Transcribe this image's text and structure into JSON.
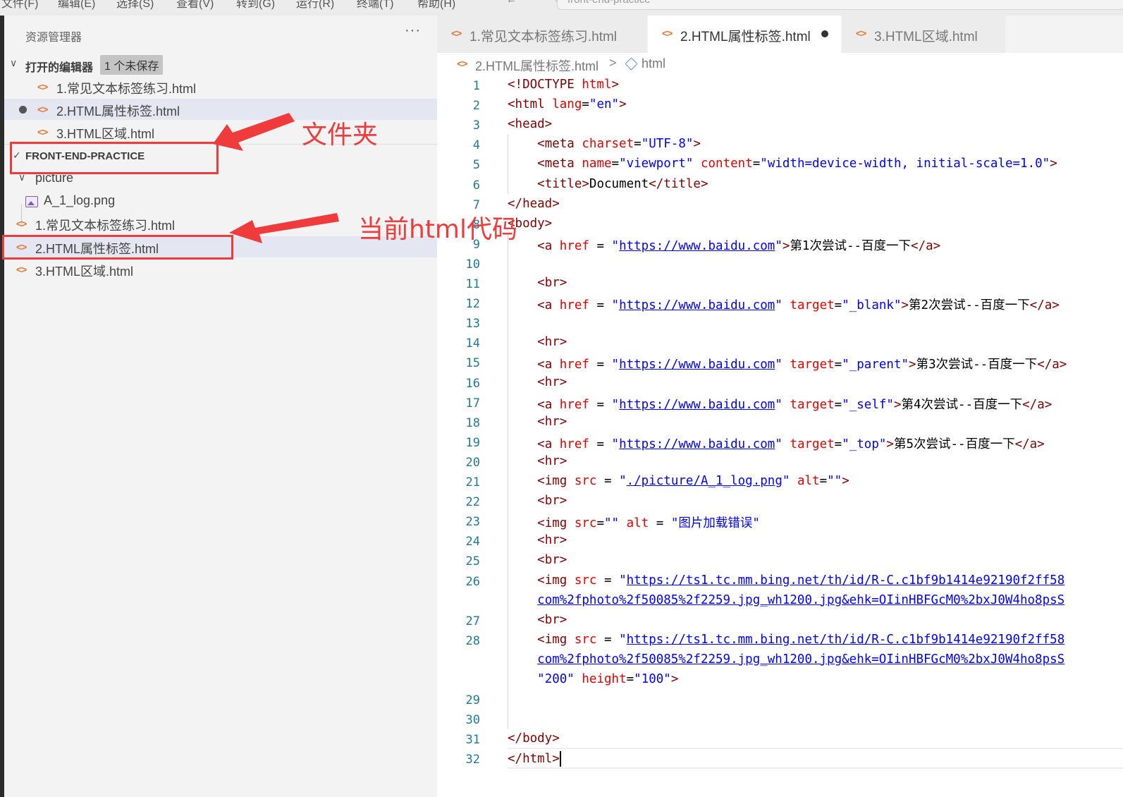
{
  "menubar": {
    "items": [
      "文件(F)",
      "编辑(E)",
      "选择(S)",
      "查看(V)",
      "转到(G)",
      "运行(R)",
      "终端(T)",
      "帮助(H)"
    ],
    "nav_arrows": "← →",
    "command_center_text": "front-end-practice"
  },
  "sidebar": {
    "title": "资源管理器",
    "more_icon": "···",
    "open_editors": {
      "label": "打开的编辑器",
      "badge": "1 个未保存",
      "files": [
        "1.常见文本标签练习.html",
        "2.HTML属性标签.html",
        "3.HTML区域.html"
      ]
    },
    "folder": {
      "label": "FRONT-END-PRACTICE",
      "subfolder": "picture",
      "subfolder_files": [
        "A_1_log.png"
      ],
      "files": [
        "1.常见文本标签练习.html",
        "2.HTML属性标签.html",
        "3.HTML区域.html"
      ]
    }
  },
  "annotations": {
    "folder_note": "文件夹",
    "current_note": "当前html代码",
    "color": "#ef3b3b"
  },
  "tabs": [
    {
      "label": "1.常见文本标签练习.html",
      "active": false,
      "dirty": false
    },
    {
      "label": "2.HTML属性标签.html",
      "active": true,
      "dirty": true
    },
    {
      "label": "3.HTML区域.html",
      "active": false,
      "dirty": false
    }
  ],
  "breadcrumb": {
    "file": "2.HTML属性标签.html",
    "separator": ">",
    "node": "html"
  },
  "editor": {
    "lines": [
      {
        "n": "1",
        "parts": [
          [
            "t",
            "<!DOCTYPE "
          ],
          [
            "a",
            "html"
          ],
          [
            "t",
            ">"
          ]
        ]
      },
      {
        "n": "2",
        "parts": [
          [
            "t",
            "<html "
          ],
          [
            "a",
            "lang"
          ],
          [
            "p",
            "="
          ],
          [
            "v",
            "\"en\""
          ],
          [
            "t",
            ">"
          ]
        ]
      },
      {
        "n": "3",
        "parts": [
          [
            "t",
            "<head>"
          ]
        ]
      },
      {
        "n": "4",
        "parts": [
          [
            "p",
            "    "
          ],
          [
            "t",
            "<meta "
          ],
          [
            "a",
            "charset"
          ],
          [
            "p",
            "="
          ],
          [
            "v",
            "\"UTF-8\""
          ],
          [
            "t",
            ">"
          ]
        ]
      },
      {
        "n": "5",
        "parts": [
          [
            "p",
            "    "
          ],
          [
            "t",
            "<meta "
          ],
          [
            "a",
            "name"
          ],
          [
            "p",
            "="
          ],
          [
            "v",
            "\"viewport\""
          ],
          [
            "p",
            " "
          ],
          [
            "a",
            "content"
          ],
          [
            "p",
            "="
          ],
          [
            "v",
            "\"width=device-width, initial-scale=1.0\""
          ],
          [
            "t",
            ">"
          ]
        ]
      },
      {
        "n": "6",
        "parts": [
          [
            "p",
            "    "
          ],
          [
            "t",
            "<title>"
          ],
          [
            "p",
            "Document"
          ],
          [
            "t",
            "</title>"
          ]
        ]
      },
      {
        "n": "7",
        "parts": [
          [
            "t",
            "</head>"
          ]
        ]
      },
      {
        "n": "8",
        "parts": [
          [
            "t",
            "<body>"
          ]
        ]
      },
      {
        "n": "9",
        "parts": [
          [
            "p",
            "    "
          ],
          [
            "t",
            "<a "
          ],
          [
            "a",
            "href"
          ],
          [
            "p",
            " = "
          ],
          [
            "v",
            "\""
          ],
          [
            "l",
            "https://www.baidu.com"
          ],
          [
            "v",
            "\""
          ],
          [
            "t",
            ">"
          ],
          [
            "p",
            "第1次尝试--百度一下"
          ],
          [
            "t",
            "</a>"
          ]
        ]
      },
      {
        "n": "10",
        "parts": []
      },
      {
        "n": "11",
        "parts": [
          [
            "p",
            "    "
          ],
          [
            "t",
            "<br>"
          ]
        ]
      },
      {
        "n": "12",
        "parts": [
          [
            "p",
            "    "
          ],
          [
            "t",
            "<a "
          ],
          [
            "a",
            "href"
          ],
          [
            "p",
            " = "
          ],
          [
            "v",
            "\""
          ],
          [
            "l",
            "https://www.baidu.com"
          ],
          [
            "v",
            "\""
          ],
          [
            "p",
            " "
          ],
          [
            "a",
            "target"
          ],
          [
            "p",
            "="
          ],
          [
            "v",
            "\"_blank\""
          ],
          [
            "t",
            ">"
          ],
          [
            "p",
            "第2次尝试--百度一下"
          ],
          [
            "t",
            "</a>"
          ]
        ]
      },
      {
        "n": "13",
        "parts": []
      },
      {
        "n": "14",
        "parts": [
          [
            "p",
            "    "
          ],
          [
            "t",
            "<hr>"
          ]
        ]
      },
      {
        "n": "15",
        "parts": [
          [
            "p",
            "    "
          ],
          [
            "t",
            "<a "
          ],
          [
            "a",
            "href"
          ],
          [
            "p",
            " = "
          ],
          [
            "v",
            "\""
          ],
          [
            "l",
            "https://www.baidu.com"
          ],
          [
            "v",
            "\""
          ],
          [
            "p",
            " "
          ],
          [
            "a",
            "target"
          ],
          [
            "p",
            "="
          ],
          [
            "v",
            "\"_parent\""
          ],
          [
            "t",
            ">"
          ],
          [
            "p",
            "第3次尝试--百度一下"
          ],
          [
            "t",
            "</a>"
          ]
        ]
      },
      {
        "n": "16",
        "parts": [
          [
            "p",
            "    "
          ],
          [
            "t",
            "<hr>"
          ]
        ]
      },
      {
        "n": "17",
        "parts": [
          [
            "p",
            "    "
          ],
          [
            "t",
            "<a "
          ],
          [
            "a",
            "href"
          ],
          [
            "p",
            " = "
          ],
          [
            "v",
            "\""
          ],
          [
            "l",
            "https://www.baidu.com"
          ],
          [
            "v",
            "\""
          ],
          [
            "p",
            " "
          ],
          [
            "a",
            "target"
          ],
          [
            "p",
            "="
          ],
          [
            "v",
            "\"_self\""
          ],
          [
            "t",
            ">"
          ],
          [
            "p",
            "第4次尝试--百度一下"
          ],
          [
            "t",
            "</a>"
          ]
        ]
      },
      {
        "n": "18",
        "parts": [
          [
            "p",
            "    "
          ],
          [
            "t",
            "<hr>"
          ]
        ]
      },
      {
        "n": "19",
        "parts": [
          [
            "p",
            "    "
          ],
          [
            "t",
            "<a "
          ],
          [
            "a",
            "href"
          ],
          [
            "p",
            " = "
          ],
          [
            "v",
            "\""
          ],
          [
            "l",
            "https://www.baidu.com"
          ],
          [
            "v",
            "\""
          ],
          [
            "p",
            " "
          ],
          [
            "a",
            "target"
          ],
          [
            "p",
            "="
          ],
          [
            "v",
            "\"_top\""
          ],
          [
            "t",
            ">"
          ],
          [
            "p",
            "第5次尝试--百度一下"
          ],
          [
            "t",
            "</a>"
          ]
        ]
      },
      {
        "n": "20",
        "parts": [
          [
            "p",
            "    "
          ],
          [
            "t",
            "<hr>"
          ]
        ]
      },
      {
        "n": "21",
        "parts": [
          [
            "p",
            "    "
          ],
          [
            "t",
            "<img "
          ],
          [
            "a",
            "src"
          ],
          [
            "p",
            " = "
          ],
          [
            "v",
            "\""
          ],
          [
            "l",
            "./picture/A_1_log.png"
          ],
          [
            "v",
            "\""
          ],
          [
            "p",
            " "
          ],
          [
            "a",
            "alt"
          ],
          [
            "p",
            "="
          ],
          [
            "v",
            "\"\""
          ],
          [
            "t",
            ">"
          ]
        ]
      },
      {
        "n": "22",
        "parts": [
          [
            "p",
            "    "
          ],
          [
            "t",
            "<br>"
          ]
        ]
      },
      {
        "n": "23",
        "parts": [
          [
            "p",
            "    "
          ],
          [
            "t",
            "<img "
          ],
          [
            "a",
            "src"
          ],
          [
            "p",
            "="
          ],
          [
            "v",
            "\"\""
          ],
          [
            "p",
            " "
          ],
          [
            "a",
            "alt"
          ],
          [
            "p",
            " = "
          ],
          [
            "v",
            "\"图片加载错误\""
          ]
        ]
      },
      {
        "n": "24",
        "parts": [
          [
            "p",
            "    "
          ],
          [
            "t",
            "<hr>"
          ]
        ]
      },
      {
        "n": "25",
        "parts": [
          [
            "p",
            "    "
          ],
          [
            "t",
            "<br>"
          ]
        ]
      },
      {
        "n": "26",
        "parts": [
          [
            "p",
            "    "
          ],
          [
            "t",
            "<img "
          ],
          [
            "a",
            "src"
          ],
          [
            "p",
            " = "
          ],
          [
            "v",
            "\""
          ],
          [
            "l",
            "https://ts1.tc.mm.bing.net/th/id/R-C.c1bf9b1414e92190f2ff58"
          ]
        ]
      },
      {
        "n": "",
        "parts": [
          [
            "p",
            "    "
          ],
          [
            "l",
            "com%2fphoto%2f50085%2f2259.jpg_wh1200.jpg&ehk=OIinHBFGcM0%2bxJ0W4ho8psS"
          ]
        ]
      },
      {
        "n": "27",
        "parts": [
          [
            "p",
            "    "
          ],
          [
            "t",
            "<br>"
          ]
        ]
      },
      {
        "n": "28",
        "parts": [
          [
            "p",
            "    "
          ],
          [
            "t",
            "<img "
          ],
          [
            "a",
            "src"
          ],
          [
            "p",
            " = "
          ],
          [
            "v",
            "\""
          ],
          [
            "l",
            "https://ts1.tc.mm.bing.net/th/id/R-C.c1bf9b1414e92190f2ff58"
          ]
        ]
      },
      {
        "n": "",
        "parts": [
          [
            "p",
            "    "
          ],
          [
            "l",
            "com%2fphoto%2f50085%2f2259.jpg_wh1200.jpg&ehk=OIinHBFGcM0%2bxJ0W4ho8psS"
          ]
        ]
      },
      {
        "n": "",
        "parts": [
          [
            "p",
            "    "
          ],
          [
            "v",
            "\"200\""
          ],
          [
            "p",
            " "
          ],
          [
            "a",
            "height"
          ],
          [
            "p",
            "="
          ],
          [
            "v",
            "\"100\""
          ],
          [
            "t",
            ">"
          ]
        ]
      },
      {
        "n": "29",
        "parts": []
      },
      {
        "n": "30",
        "parts": []
      },
      {
        "n": "31",
        "parts": [
          [
            "t",
            "</body>"
          ]
        ]
      },
      {
        "n": "32",
        "parts": [
          [
            "t",
            "</html>"
          ]
        ]
      }
    ]
  }
}
